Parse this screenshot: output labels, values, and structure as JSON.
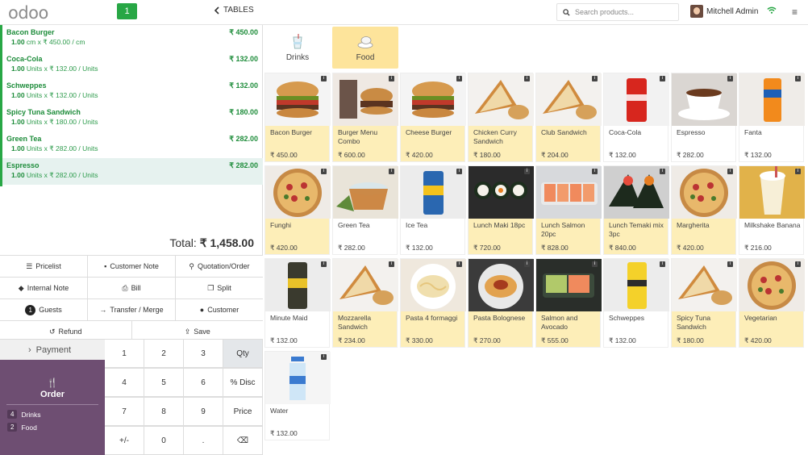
{
  "topbar": {
    "logo": "odoo",
    "order_badge": "1",
    "tables_label": "TABLES",
    "search_placeholder": "Search products...",
    "user_name": "Mitchell Admin"
  },
  "orderlines": [
    {
      "name": "Bacon Burger",
      "qty": "1.00",
      "detail": "cm x ₹ 450.00 / cm",
      "price": "₹ 450.00"
    },
    {
      "name": "Coca-Cola",
      "qty": "1.00",
      "detail": "Units x ₹ 132.00 / Units",
      "price": "₹ 132.00"
    },
    {
      "name": "Schweppes",
      "qty": "1.00",
      "detail": "Units x ₹ 132.00 / Units",
      "price": "₹ 132.00"
    },
    {
      "name": "Spicy Tuna Sandwich",
      "qty": "1.00",
      "detail": "Units x ₹ 180.00 / Units",
      "price": "₹ 180.00"
    },
    {
      "name": "Green Tea",
      "qty": "1.00",
      "detail": "Units x ₹ 282.00 / Units",
      "price": "₹ 282.00"
    },
    {
      "name": "Espresso",
      "qty": "1.00",
      "detail": "Units x ₹ 282.00 / Units",
      "price": "₹ 282.00"
    }
  ],
  "total": {
    "label": "Total:",
    "value": "₹ 1,458.00"
  },
  "controls": {
    "pricelist": "Pricelist",
    "customer_note": "Customer Note",
    "quotation": "Quotation/Order",
    "internal_note": "Internal Note",
    "bill": "Bill",
    "split": "Split",
    "guests_count": "1",
    "guests": "Guests",
    "transfer": "Transfer / Merge",
    "customer": "Customer",
    "refund": "Refund",
    "save": "Save"
  },
  "payment_label": "Payment",
  "order": {
    "label": "Order",
    "categories": [
      {
        "count": "4",
        "name": "Drinks"
      },
      {
        "count": "2",
        "name": "Food"
      }
    ]
  },
  "numpad": [
    [
      "1",
      "2",
      "3",
      "Qty"
    ],
    [
      "4",
      "5",
      "6",
      "% Disc"
    ],
    [
      "7",
      "8",
      "9",
      "Price"
    ],
    [
      "+/-",
      "0",
      ".",
      "⌫"
    ]
  ],
  "categories": [
    {
      "name": "Drinks",
      "icon": "drinks-icon"
    },
    {
      "name": "Food",
      "icon": "food-icon"
    }
  ],
  "products": [
    {
      "name": "Bacon Burger",
      "price": "₹ 450.00",
      "food": true,
      "img": "burger"
    },
    {
      "name": "Burger Menu Combo",
      "price": "₹ 600.00",
      "food": true,
      "img": "combo"
    },
    {
      "name": "Cheese Burger",
      "price": "₹ 420.00",
      "food": true,
      "img": "burger"
    },
    {
      "name": "Chicken Curry Sandwich",
      "price": "₹ 180.00",
      "food": true,
      "img": "sandwich"
    },
    {
      "name": "Club Sandwich",
      "price": "₹ 204.00",
      "food": true,
      "img": "sandwich"
    },
    {
      "name": "Coca-Cola",
      "price": "₹ 132.00",
      "food": false,
      "img": "coke"
    },
    {
      "name": "Espresso",
      "price": "₹ 282.00",
      "food": false,
      "img": "espresso"
    },
    {
      "name": "Fanta",
      "price": "₹ 132.00",
      "food": false,
      "img": "fanta"
    },
    {
      "name": "Funghi",
      "price": "₹ 420.00",
      "food": true,
      "img": "pizza"
    },
    {
      "name": "Green Tea",
      "price": "₹ 282.00",
      "food": false,
      "img": "tea"
    },
    {
      "name": "Ice Tea",
      "price": "₹ 132.00",
      "food": false,
      "img": "icetea"
    },
    {
      "name": "Lunch Maki 18pc",
      "price": "₹ 720.00",
      "food": true,
      "img": "maki"
    },
    {
      "name": "Lunch Salmon 20pc",
      "price": "₹ 828.00",
      "food": true,
      "img": "salmon"
    },
    {
      "name": "Lunch Temaki mix 3pc",
      "price": "₹ 840.00",
      "food": true,
      "img": "temaki"
    },
    {
      "name": "Margherita",
      "price": "₹ 420.00",
      "food": true,
      "img": "pizza"
    },
    {
      "name": "Milkshake Banana",
      "price": "₹ 216.00",
      "food": false,
      "img": "milkshake"
    },
    {
      "name": "Minute Maid",
      "price": "₹ 132.00",
      "food": false,
      "img": "can"
    },
    {
      "name": "Mozzarella Sandwich",
      "price": "₹ 234.00",
      "food": true,
      "img": "sandwich"
    },
    {
      "name": "Pasta 4 formaggi",
      "price": "₹ 330.00",
      "food": true,
      "img": "pasta"
    },
    {
      "name": "Pasta Bolognese",
      "price": "₹ 270.00",
      "food": true,
      "img": "bolognese"
    },
    {
      "name": "Salmon and Avocado",
      "price": "₹ 555.00",
      "food": true,
      "img": "avocado"
    },
    {
      "name": "Schweppes",
      "price": "₹ 132.00",
      "food": false,
      "img": "schweppes"
    },
    {
      "name": "Spicy Tuna Sandwich",
      "price": "₹ 180.00",
      "food": true,
      "img": "sandwich"
    },
    {
      "name": "Vegetarian",
      "price": "₹ 420.00",
      "food": true,
      "img": "pizza"
    },
    {
      "name": "Water",
      "price": "₹ 132.00",
      "food": false,
      "img": "water"
    }
  ],
  "colors": {
    "accent": "#28a745",
    "order_panel": "#6e4e72",
    "food_tile": "#fdeeb8",
    "active_category": "#fde49b"
  }
}
